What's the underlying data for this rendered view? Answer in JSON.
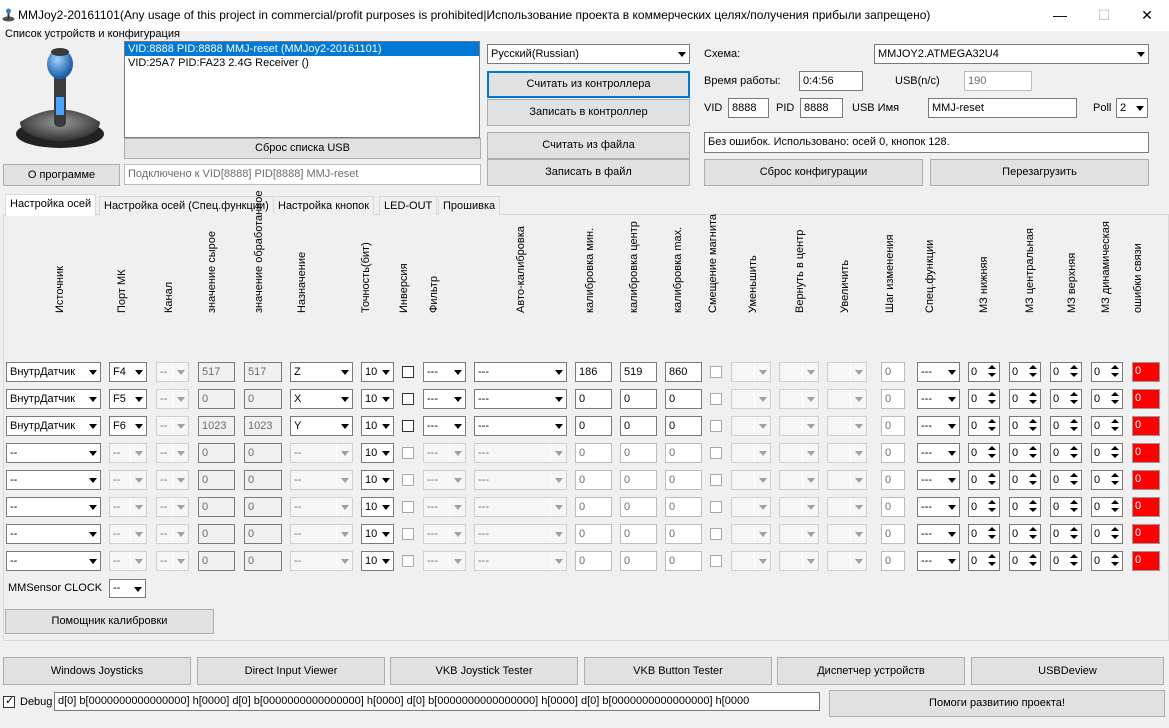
{
  "window": {
    "title": "MMJoy2-20161101(Any usage of this project in commercial/profit purposes is prohibited|Использование проекта в коммерческих целях/получения прибыли запрещено)",
    "minimize": "—",
    "maximize": "☐",
    "close": "✕"
  },
  "devices": {
    "group_label": "Список устройств и конфигурация",
    "list": [
      "VID:8888 PID:8888 MMJ-reset (MMJoy2-20161101)",
      "VID:25A7 PID:FA23 2.4G Receiver ()"
    ],
    "reset_usb": "Сброс списка USB",
    "about": "О программе",
    "connected": "Подключено к VID[8888] PID[8888] MMJ-reset"
  },
  "controller": {
    "language": "Русский(Russian)",
    "read_ctrl": "Считать из контроллера",
    "write_ctrl": "Записать в контроллер",
    "read_file": "Считать из файла",
    "write_file": "Записать в файл"
  },
  "info": {
    "schema_label": "Схема:",
    "schema_value": "MMJOY2.ATMEGA32U4",
    "uptime_label": "Время работы:",
    "uptime_value": "0:4:56",
    "usb_label": "USB(n/c)",
    "usb_value": "190",
    "vid_label": "VID",
    "vid_value": "8888",
    "pid_label": "PID",
    "pid_value": "8888",
    "usbname_label": "USB Имя",
    "usbname_value": "MMJ-reset",
    "poll_label": "Poll",
    "poll_value": "2",
    "status": "Без ошибок. Использовано: осей  0, кнопок  128.",
    "reset_cfg": "Сброс конфигурации",
    "reboot": "Перезагрузить"
  },
  "tabs": [
    "Настройка осей",
    "Настройка осей (Спец.функции)",
    "Настройка кнопок",
    "LED-OUT",
    "Прошивка"
  ],
  "columns": [
    "Источник",
    "Порт МК",
    "Канал",
    "значение сырое",
    "значение обработанное",
    "Назначение",
    "Точность(бит)",
    "Инверсия",
    "Фильтр",
    "Авто-калибровка",
    "калибровка мин.",
    "калибровка центр",
    "калибровка max.",
    "Смещение магнита",
    "Уменьшить",
    "Вернуть в центр",
    "Увеличить",
    "Шаг изменения",
    "Спец.функции",
    "МЗ нижняя",
    "МЗ центральная",
    "МЗ верхняя",
    "МЗ динамическая",
    "ошибки связи"
  ],
  "rows": [
    {
      "src": "ВнутрДатчик",
      "port": "F4",
      "ch": "--",
      "raw": "517",
      "proc": "517",
      "assign": "Z",
      "bits": "10",
      "filter": "---",
      "auto": "---",
      "cmin": "186",
      "cmid": "519",
      "cmax": "860",
      "step": "0",
      "spec": "---",
      "mzl": "0",
      "mzc": "0",
      "mzu": "0",
      "mzd": "0",
      "err": "0"
    },
    {
      "src": "ВнутрДатчик",
      "port": "F5",
      "ch": "--",
      "raw": "0",
      "proc": "0",
      "assign": "X",
      "bits": "10",
      "filter": "---",
      "auto": "---",
      "cmin": "0",
      "cmid": "0",
      "cmax": "0",
      "step": "0",
      "spec": "---",
      "mzl": "0",
      "mzc": "0",
      "mzu": "0",
      "mzd": "0",
      "err": "0"
    },
    {
      "src": "ВнутрДатчик",
      "port": "F6",
      "ch": "--",
      "raw": "1023",
      "proc": "1023",
      "assign": "Y",
      "bits": "10",
      "filter": "---",
      "auto": "---",
      "cmin": "0",
      "cmid": "0",
      "cmax": "0",
      "step": "0",
      "spec": "---",
      "mzl": "0",
      "mzc": "0",
      "mzu": "0",
      "mzd": "0",
      "err": "0"
    },
    {
      "src": "--",
      "port": "--",
      "ch": "--",
      "raw": "0",
      "proc": "0",
      "assign": "--",
      "bits": "10",
      "filter": "---",
      "auto": "---",
      "cmin": "0",
      "cmid": "0",
      "cmax": "0",
      "step": "0",
      "spec": "---",
      "mzl": "0",
      "mzc": "0",
      "mzu": "0",
      "mzd": "0",
      "err": "0"
    },
    {
      "src": "--",
      "port": "--",
      "ch": "--",
      "raw": "0",
      "proc": "0",
      "assign": "--",
      "bits": "10",
      "filter": "---",
      "auto": "---",
      "cmin": "0",
      "cmid": "0",
      "cmax": "0",
      "step": "0",
      "spec": "---",
      "mzl": "0",
      "mzc": "0",
      "mzu": "0",
      "mzd": "0",
      "err": "0"
    },
    {
      "src": "--",
      "port": "--",
      "ch": "--",
      "raw": "0",
      "proc": "0",
      "assign": "--",
      "bits": "10",
      "filter": "---",
      "auto": "---",
      "cmin": "0",
      "cmid": "0",
      "cmax": "0",
      "step": "0",
      "spec": "---",
      "mzl": "0",
      "mzc": "0",
      "mzu": "0",
      "mzd": "0",
      "err": "0"
    },
    {
      "src": "--",
      "port": "--",
      "ch": "--",
      "raw": "0",
      "proc": "0",
      "assign": "--",
      "bits": "10",
      "filter": "---",
      "auto": "---",
      "cmin": "0",
      "cmid": "0",
      "cmax": "0",
      "step": "0",
      "spec": "---",
      "mzl": "0",
      "mzc": "0",
      "mzu": "0",
      "mzd": "0",
      "err": "0"
    },
    {
      "src": "--",
      "port": "--",
      "ch": "--",
      "raw": "0",
      "proc": "0",
      "assign": "--",
      "bits": "10",
      "filter": "---",
      "auto": "---",
      "cmin": "0",
      "cmid": "0",
      "cmax": "0",
      "step": "0",
      "spec": "---",
      "mzl": "0",
      "mzc": "0",
      "mzu": "0",
      "mzd": "0",
      "err": "0"
    }
  ],
  "mmsensor": {
    "label": "MMSensor CLOCK",
    "value": "--"
  },
  "calib_helper": "Помощник калибровки",
  "bottom_buttons": [
    "Windows Joysticks",
    "Direct Input Viewer",
    "VKB Joystick Tester",
    "VKB Button Tester",
    "Диспетчер устройств",
    "USBDeview"
  ],
  "debug": {
    "label": "Debug",
    "text": "d[0] b[0000000000000000] h[0000]   d[0] b[0000000000000000] h[0000]   d[0] b[0000000000000000] h[0000]   d[0] b[0000000000000000] h[0000"
  },
  "help": "Помоги развитию проекта!",
  "colors": {
    "error_cell": "#ff0000",
    "selection": "#0078d7"
  }
}
